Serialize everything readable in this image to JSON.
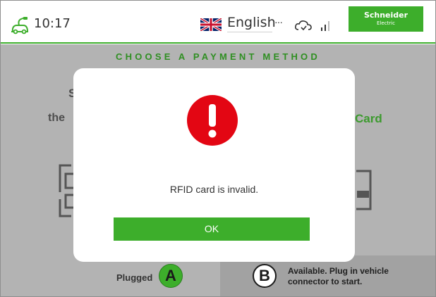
{
  "header": {
    "time": "10:17",
    "language": "English",
    "more_indicator": "···",
    "brand_name": "Schneider",
    "brand_sub": "Electric",
    "icons": [
      "plug-car-icon",
      "uk-flag-icon",
      "cloud-icon",
      "signal-icon"
    ]
  },
  "main": {
    "title": "CHOOSE A PAYMENT METHOD",
    "left_fragment_s": "S",
    "left_fragment_the": "the",
    "right_fragment_card": "Card"
  },
  "connectors": {
    "a": {
      "letter": "A",
      "status": "Plugged"
    },
    "b": {
      "letter": "B",
      "status_line1": "Available. Plug in vehicle",
      "status_line2": "connector to start."
    }
  },
  "dialog": {
    "icon": "alert-icon",
    "message": "RFID card is invalid.",
    "ok_label": "OK"
  },
  "colors": {
    "brand_green": "#3dae2b",
    "alert_red": "#e30613",
    "overlay_grey": "#b3b3b3"
  }
}
